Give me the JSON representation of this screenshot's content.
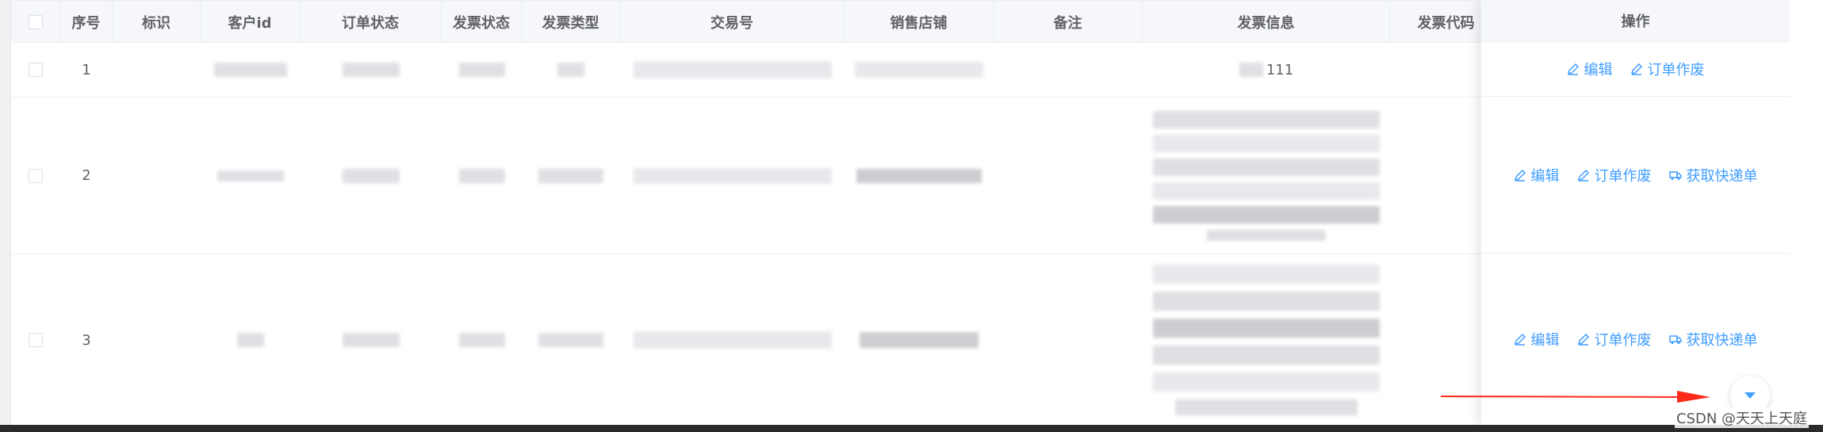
{
  "columns": [
    "序号",
    "标识",
    "客户id",
    "订单状态",
    "发票状态",
    "发票类型",
    "交易号",
    "销售店铺",
    "备注",
    "发票信息",
    "发票代码",
    "操作"
  ],
  "rows": [
    {
      "index": "1",
      "invoice_text": "111"
    },
    {
      "index": "2"
    },
    {
      "index": "3"
    }
  ],
  "actions": {
    "edit": "编辑",
    "void_order": "订单作废",
    "get_express": "获取快递单"
  },
  "watermark": "CSDN @天天上天庭",
  "colors": {
    "link": "#409eff",
    "arrow": "#ff2a1a",
    "header_bg": "#f5f7fa"
  },
  "icons": [
    "edit-icon",
    "truck-icon",
    "chevron-down-icon",
    "arrow-right-icon"
  ]
}
